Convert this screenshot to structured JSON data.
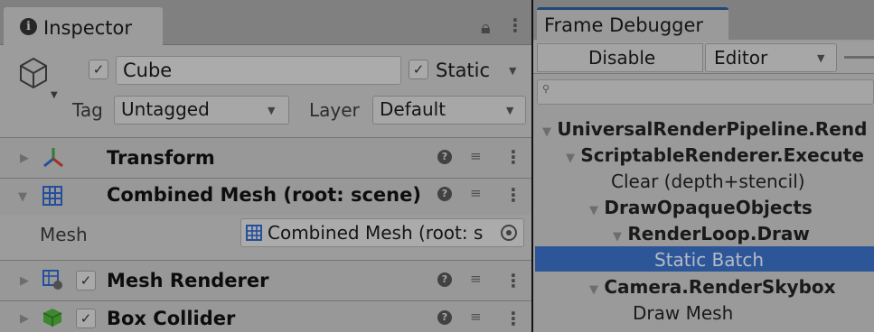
{
  "inspector": {
    "tab_title": "Inspector",
    "object_name": "Cube",
    "static_label": "Static",
    "tag_label": "Tag",
    "tag_value": "Untagged",
    "layer_label": "Layer",
    "layer_value": "Default",
    "components": [
      {
        "title": "Transform"
      },
      {
        "title": "Combined Mesh (root: scene)",
        "field_label": "Mesh",
        "field_value": "Combined Mesh (root: s"
      },
      {
        "title": "Mesh Renderer"
      },
      {
        "title": "Box Collider"
      }
    ]
  },
  "frame_debugger": {
    "tab_title": "Frame Debugger",
    "disable_label": "Disable",
    "mode_value": "Editor",
    "tree": [
      "UniversalRenderPipeline.Rend",
      "ScriptableRenderer.Execute",
      "Clear (depth+stencil)",
      "DrawOpaqueObjects",
      "RenderLoop.Draw",
      "Static Batch",
      "Camera.RenderSkybox",
      "Draw Mesh"
    ]
  },
  "colors": {
    "selection": "#3a6fc4",
    "tab_accent": "#2c5d9e"
  }
}
